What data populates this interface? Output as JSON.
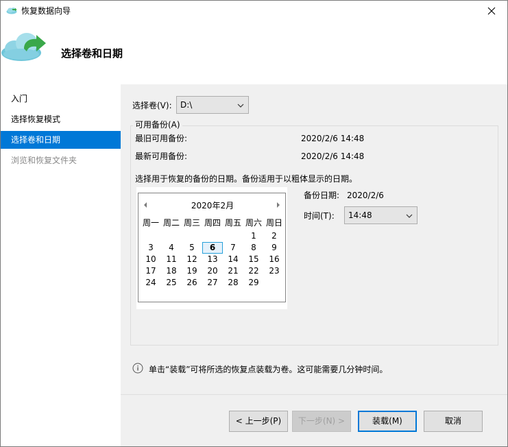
{
  "window": {
    "title": "恢复数据向导"
  },
  "header": {
    "title": "选择卷和日期"
  },
  "sidebar": {
    "items": [
      {
        "label": "入门",
        "state": "normal"
      },
      {
        "label": "选择恢复模式",
        "state": "normal"
      },
      {
        "label": "选择卷和日期",
        "state": "active"
      },
      {
        "label": "浏览和恢复文件夹",
        "state": "disabled"
      }
    ]
  },
  "volume": {
    "label": "选择卷(V):",
    "value": "D:\\"
  },
  "backups": {
    "group_label": "可用备份(A)",
    "oldest_label": "最旧可用备份:",
    "oldest_value": "2020/2/6 14:48",
    "newest_label": "最新可用备份:",
    "newest_value": "2020/2/6 14:48",
    "instruction": "选择用于恢复的备份的日期。备份适用于以粗体显示的日期。"
  },
  "calendar": {
    "month_label": "2020年2月",
    "weekdays": [
      "周一",
      "周二",
      "周三",
      "周四",
      "周五",
      "周六",
      "周日"
    ],
    "weeks": [
      [
        "",
        "",
        "",
        "",
        "",
        "1",
        "2"
      ],
      [
        "3",
        "4",
        "5",
        "6",
        "7",
        "8",
        "9"
      ],
      [
        "10",
        "11",
        "12",
        "13",
        "14",
        "15",
        "16"
      ],
      [
        "17",
        "18",
        "19",
        "20",
        "21",
        "22",
        "23"
      ],
      [
        "24",
        "25",
        "26",
        "27",
        "28",
        "29",
        ""
      ]
    ],
    "selected_day": "6"
  },
  "backup_date": {
    "label": "备份日期:",
    "value": "2020/2/6"
  },
  "time": {
    "label": "时间(T):",
    "value": "14:48"
  },
  "info": {
    "text": "单击“装载”可将所选的恢复点装载为卷。这可能需要几分钟时间。"
  },
  "buttons": {
    "back": "< 上一步(P)",
    "next": "下一步(N) >",
    "mount": "装载(M)",
    "cancel": "取消"
  },
  "colors": {
    "accent": "#0078d7",
    "content_bg": "#f0f0f0",
    "cloud": "#7fcfe0",
    "arrow": "#3aa84a"
  },
  "icons": {
    "title": "cloud-sync-icon",
    "header": "cloud-restore-icon",
    "close": "close-icon",
    "info": "info-icon",
    "dropdown": "chevron-down-icon",
    "prev_month": "triangle-left-icon",
    "next_month": "triangle-right-icon"
  }
}
